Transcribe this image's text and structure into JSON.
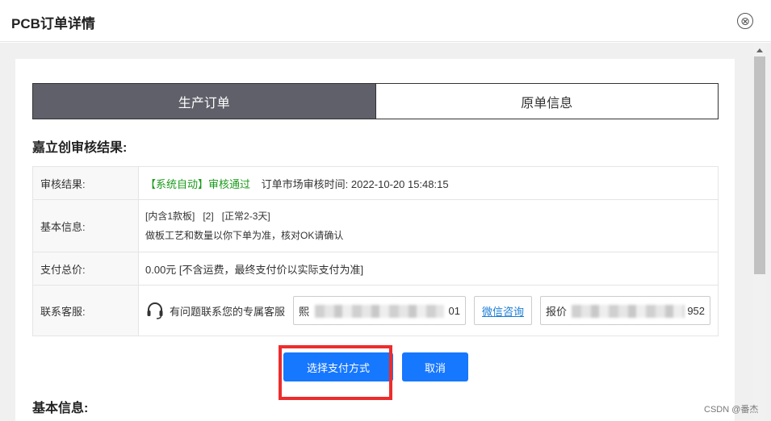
{
  "dialog": {
    "title": "PCB订单详情",
    "close_icon": "⊗"
  },
  "tabs": [
    {
      "label": "生产订单",
      "active": true
    },
    {
      "label": "原单信息",
      "active": false
    }
  ],
  "review": {
    "heading": "嘉立创审核结果:",
    "rows": {
      "result": {
        "label": "审核结果:",
        "status": "【系统自动】审核通过",
        "time": "订单市场审核时间: 2022-10-20 15:48:15"
      },
      "basic": {
        "label": "基本信息:",
        "line1": "[内含1款板]   [2]   [正常2-3天]",
        "line2": "做板工艺和数量以你下单为准，核对OK请确认"
      },
      "total": {
        "label": "支付总价:",
        "value": "0.00元 [不含运费，最终支付价以实际支付为准]"
      },
      "contact": {
        "label": "联系客服:",
        "text": "有问题联系您的专属客服",
        "box1_prefix": "熙",
        "box1_suffix": "01",
        "wechat": "微信咨询",
        "box2_prefix": "报价",
        "box2_suffix": "952"
      }
    }
  },
  "actions": {
    "pay": "选择支付方式",
    "cancel": "取消"
  },
  "section2": {
    "heading": "基本信息:"
  },
  "watermark": "CSDN @番杰",
  "colors": {
    "primary": "#1677ff",
    "tab_active": "#5f6069",
    "success": "#1a9a1a",
    "highlight": "#ee2c2c"
  }
}
